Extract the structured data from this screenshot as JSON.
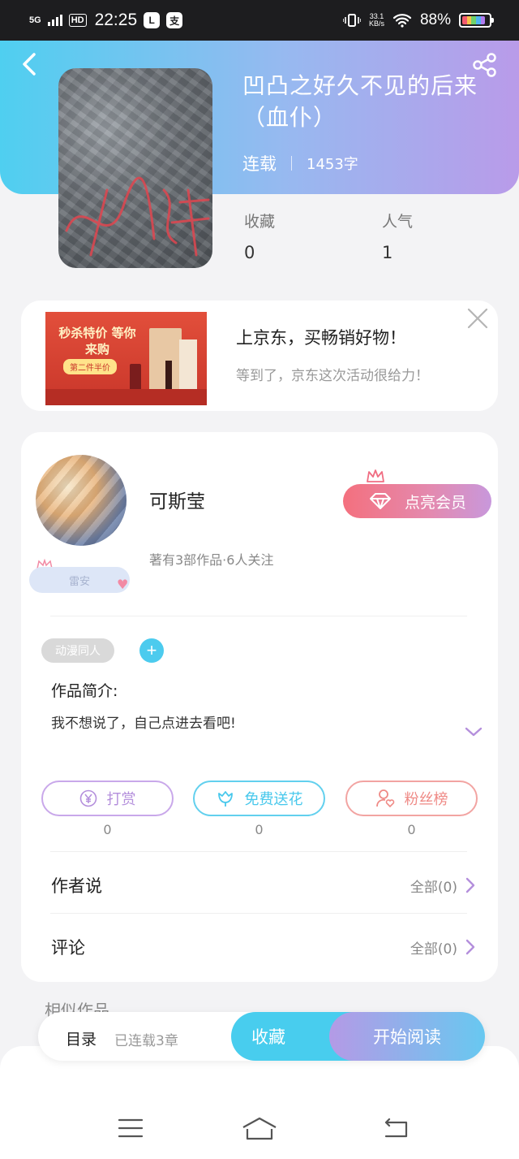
{
  "status_bar": {
    "network": "5G",
    "hd": "HD",
    "time": "22:25",
    "app_icons": [
      "L",
      "支"
    ],
    "speed_value": "33.1",
    "speed_unit": "KB/s",
    "battery": "88%"
  },
  "book": {
    "title": "凹凸之好久不见的后来（血仆）",
    "status": "连载",
    "word_count": "1453字",
    "stats": [
      {
        "label": "收藏",
        "value": "0"
      },
      {
        "label": "人气",
        "value": "1"
      }
    ]
  },
  "ad": {
    "title": "上京东，买畅销好物！",
    "description": "等到了，京东这次活动很给力！",
    "image_headline": "秒杀特价 等你来购",
    "image_tag": "第二件半价"
  },
  "author": {
    "name": "可斯莹",
    "summary": "著有3部作品·6人关注",
    "badge": "雷安",
    "vip_button": "点亮会员"
  },
  "tags": {
    "items": [
      "动漫同人"
    ],
    "add_label": "+"
  },
  "intro": {
    "label": "作品简介:",
    "text": "我不想说了，自己点进去看吧!"
  },
  "actions": [
    {
      "label": "打赏",
      "count": "0",
      "color": "#b48fdc"
    },
    {
      "label": "免费送花",
      "count": "0",
      "color": "#48c8ec"
    },
    {
      "label": "粉丝榜",
      "count": "0",
      "color": "#ef8a86"
    }
  ],
  "rows": [
    {
      "label": "作者说",
      "link": "全部(0)"
    },
    {
      "label": "评论",
      "link": "全部(0)"
    }
  ],
  "similar": {
    "label": "相似作品"
  },
  "bottom_bar": {
    "toc": "目录",
    "chapters": "已连载3章",
    "favorite": "收藏",
    "read": "开始阅读"
  },
  "colors": {
    "header_start": "#4fcff0",
    "header_end": "#b99be9",
    "accent_blue": "#48cdee",
    "accent_purple": "#b48fdc"
  }
}
